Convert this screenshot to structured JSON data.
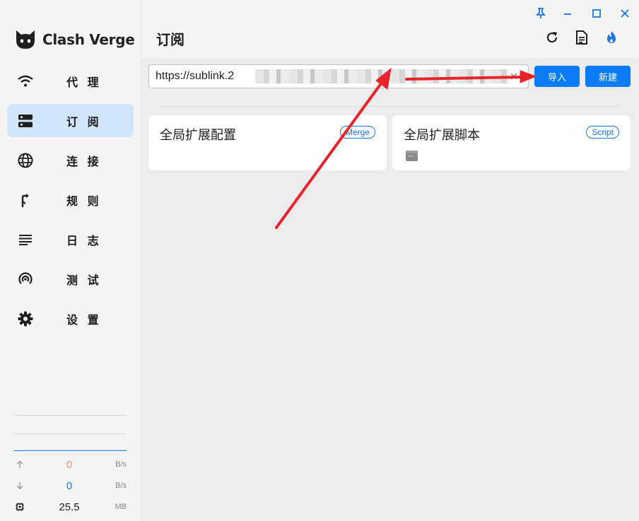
{
  "app": {
    "name": "Clash Verge"
  },
  "sidebar": {
    "items": [
      {
        "label": "代 理",
        "icon": "wifi-icon"
      },
      {
        "label": "订 阅",
        "icon": "storage-icon",
        "active": true
      },
      {
        "label": "连 接",
        "icon": "globe-icon"
      },
      {
        "label": "规 则",
        "icon": "route-icon"
      },
      {
        "label": "日 志",
        "icon": "lines-icon"
      },
      {
        "label": "测 试",
        "icon": "radar-icon"
      },
      {
        "label": "设 置",
        "icon": "gear-icon"
      }
    ],
    "traffic": {
      "upload": {
        "value": "0",
        "unit": "B/s",
        "color": "#f08c6b"
      },
      "download": {
        "value": "0",
        "unit": "B/s",
        "color": "#1a73e8"
      },
      "memory": {
        "value": "25.5",
        "unit": "MB"
      }
    }
  },
  "header": {
    "title": "订阅"
  },
  "import_bar": {
    "url_value": "https://sublink.2",
    "import_label": "导入",
    "new_label": "新建"
  },
  "cards": [
    {
      "title": "全局扩展配置",
      "badge": "Merge"
    },
    {
      "title": "全局扩展脚本",
      "badge": "Script"
    }
  ],
  "colors": {
    "accent": "#0b7cf5",
    "arrow": "#e8232b",
    "active_nav": "#d2e5f9"
  }
}
